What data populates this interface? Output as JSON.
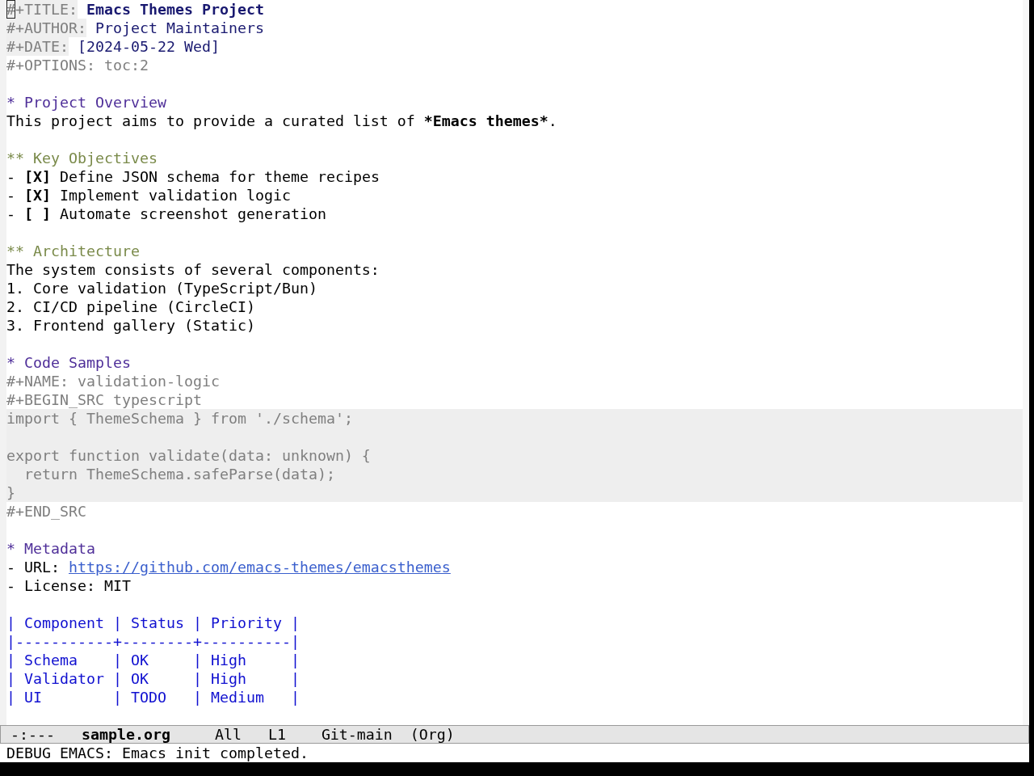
{
  "buffer": {
    "keywords": [
      {
        "kind": "title",
        "key": "#+TITLE:",
        "value": "Emacs Themes Project",
        "cursor": true
      },
      {
        "kind": "author",
        "key": "#+AUTHOR:",
        "value": "Project Maintainers",
        "cursor": false
      },
      {
        "kind": "date",
        "key": "#+DATE:",
        "value": "[2024-05-22 Wed]",
        "cursor": false
      },
      {
        "kind": "options",
        "key": "#+OPTIONS:",
        "value": "toc:2",
        "cursor": false
      }
    ],
    "outline": [
      {
        "heading": "* Project Overview",
        "body": [
          {
            "kind": "paragraph",
            "segments": [
              {
                "text": "This project aims to provide a curated list of ",
                "bold": false
              },
              {
                "text": "*Emacs themes*",
                "bold": true
              },
              {
                "text": ".",
                "bold": false
              }
            ]
          }
        ],
        "children": [
          {
            "heading": "** Key Objectives",
            "body": [
              {
                "kind": "checkbox",
                "bullet": "-",
                "box": "[X]",
                "text": "Define JSON schema for theme recipes"
              },
              {
                "kind": "checkbox",
                "bullet": "-",
                "box": "[X]",
                "text": "Implement validation logic"
              },
              {
                "kind": "checkbox",
                "bullet": "-",
                "box": "[ ]",
                "text": "Automate screenshot generation"
              }
            ]
          },
          {
            "heading": "** Architecture",
            "body": [
              {
                "kind": "paragraph",
                "segments": [
                  {
                    "text": "The system consists of several components:",
                    "bold": false
                  }
                ]
              },
              {
                "kind": "numbered",
                "number": "1.",
                "text": "Core validation (TypeScript/Bun)"
              },
              {
                "kind": "numbered",
                "number": "2.",
                "text": "CI/CD pipeline (CircleCI)"
              },
              {
                "kind": "numbered",
                "number": "3.",
                "text": "Frontend gallery (Static)"
              }
            ]
          }
        ]
      },
      {
        "heading": "* Code Samples",
        "body": [
          {
            "kind": "src_block",
            "name_line": "#+NAME: validation-logic",
            "begin_line": "#+BEGIN_SRC typescript",
            "code": "import { ThemeSchema } from './schema';\n\nexport function validate(data: unknown) {\n  return ThemeSchema.safeParse(data);\n}",
            "end_line": "#+END_SRC"
          }
        ]
      },
      {
        "heading": "* Metadata",
        "body": [
          {
            "kind": "link_item",
            "text": "- URL:",
            "url": "https://github.com/emacs-themes/emacsthemes"
          },
          {
            "kind": "item",
            "text": "- License: MIT"
          },
          {
            "kind": "table",
            "header": "| Component | Status | Priority |",
            "rule": "|-----------+--------+----------|",
            "rows": [
              "| Schema    | OK     | High     |",
              "| Validator | OK     | High     |",
              "| UI        | TODO   | Medium   |"
            ]
          }
        ]
      }
    ]
  },
  "mode_line": {
    "status": "-:---",
    "buffer": "sample.org",
    "position": "All",
    "line": "L1",
    "vc": "Git-main",
    "mode": "(Org)"
  },
  "echo_area": "DEBUG EMACS: Emacs init completed."
}
